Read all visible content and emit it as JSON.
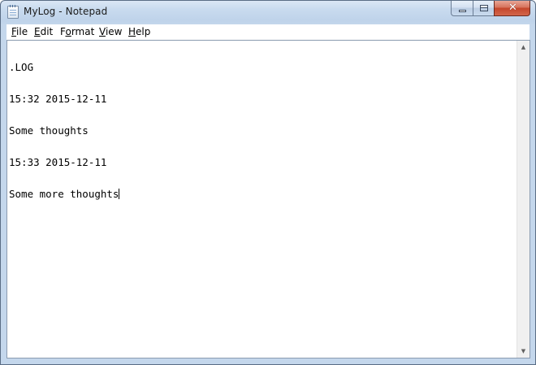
{
  "window": {
    "title": "MyLog - Notepad",
    "icon": "notepad-icon",
    "controls": {
      "minimize": "minimize-icon",
      "maximize": "maximize-icon",
      "close_glyph": "✕"
    }
  },
  "menu": {
    "items": [
      {
        "accel": "F",
        "rest": "ile"
      },
      {
        "accel": "E",
        "rest": "dit"
      },
      {
        "pre": "F",
        "accel": "o",
        "rest": "rmat"
      },
      {
        "accel": "V",
        "rest": "iew"
      },
      {
        "accel": "H",
        "rest": "elp"
      }
    ]
  },
  "editor": {
    "lines": [
      ".LOG",
      "15:32 2015-12-11",
      "Some thoughts",
      "15:33 2015-12-11",
      "Some more thoughts"
    ]
  },
  "scrollbar": {
    "up_arrow": "▲",
    "down_arrow": "▼"
  },
  "colors": {
    "frame": "#c4d7ec",
    "close_button": "#c4462b"
  }
}
